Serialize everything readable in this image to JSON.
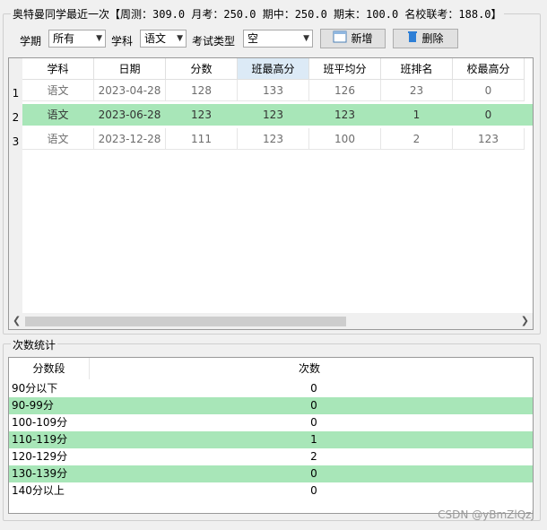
{
  "header": {
    "title": "奥特曼同学最近一次【周测：309.0 月考：250.0 期中：250.0 期末：100.0 名校联考：188.0】"
  },
  "filters": {
    "term_label": "学期",
    "term_value": "所有",
    "subject_label": "学科",
    "subject_value": "语文",
    "exam_type_label": "考试类型",
    "exam_type_value": "空",
    "add_label": "新增",
    "delete_label": "删除"
  },
  "scores_table": {
    "columns": [
      "学科",
      "日期",
      "分数",
      "班最高分",
      "班平均分",
      "班排名",
      "校最高分"
    ],
    "rows": [
      {
        "num": "1",
        "cells": [
          "语文",
          "2023-04-28",
          "128",
          "133",
          "126",
          "23",
          "0"
        ]
      },
      {
        "num": "2",
        "cells": [
          "语文",
          "2023-06-28",
          "123",
          "123",
          "123",
          "1",
          "0"
        ]
      },
      {
        "num": "3",
        "cells": [
          "语文",
          "2023-12-28",
          "111",
          "123",
          "100",
          "2",
          "123"
        ]
      }
    ],
    "highlight_color": "#a8e6b8"
  },
  "stats": {
    "title": "次数统计",
    "columns": [
      "分数段",
      "次数"
    ],
    "rows": [
      {
        "range": "90分以下",
        "count": "0"
      },
      {
        "range": "90-99分",
        "count": "0"
      },
      {
        "range": "100-109分",
        "count": "0"
      },
      {
        "range": "110-119分",
        "count": "1"
      },
      {
        "range": "120-129分",
        "count": "2"
      },
      {
        "range": "130-139分",
        "count": "0"
      },
      {
        "range": "140分以上",
        "count": "0"
      }
    ]
  },
  "watermark": "CSDN @yBmZlQzJ"
}
